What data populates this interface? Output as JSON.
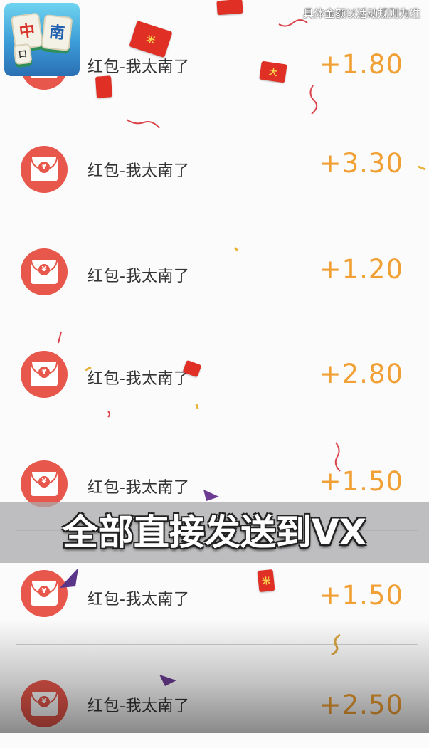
{
  "app_icon": {
    "tile_1": "中",
    "tile_2": "南",
    "tile_3": "口"
  },
  "disclaimer": "具体金额以活动规则为准",
  "records": [
    {
      "title": "红包-我太南了",
      "amount": "+1.80"
    },
    {
      "title": "红包-我太南了",
      "amount": "+3.30"
    },
    {
      "title": "红包-我太南了",
      "amount": "+1.20"
    },
    {
      "title": "红包-我太南了",
      "amount": "+2.80"
    },
    {
      "title": "红包-我太南了",
      "amount": "+1.50"
    },
    {
      "title": "红包-我太南了",
      "amount": "+1.50"
    },
    {
      "title": "红包-我太南了",
      "amount": "+2.50"
    }
  ],
  "envelope_icon": {
    "symbol": "¥",
    "color": "#e8574b"
  },
  "banner": {
    "text": "全部直接发送到VX"
  },
  "colors": {
    "amount": "#f0a034",
    "divider": "#cfcfd3",
    "background": "#fbfbfc"
  }
}
